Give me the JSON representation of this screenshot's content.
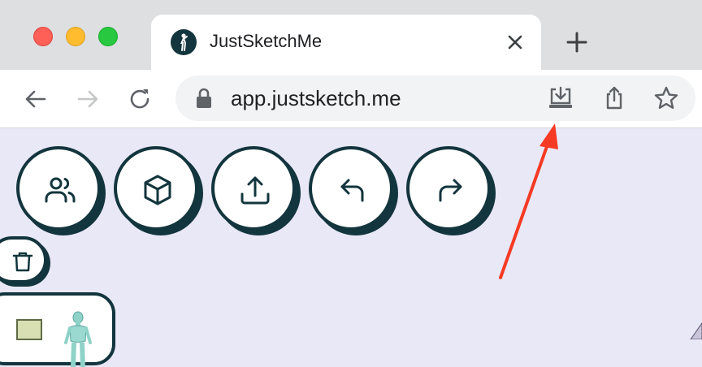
{
  "window": {
    "traffic_lights": [
      "close",
      "minimize",
      "zoom"
    ]
  },
  "tab": {
    "title": "JustSketchMe",
    "favicon": "mannequin-logo-icon"
  },
  "toolbar": {
    "url": "app.justsketch.me",
    "icons": [
      "back-icon",
      "forward-icon",
      "reload-icon",
      "lock-icon",
      "install-app-icon",
      "share-icon",
      "bookmark-star-icon"
    ]
  },
  "app": {
    "buttons": [
      "users-icon",
      "cube-icon",
      "upload-icon",
      "undo-icon",
      "redo-icon"
    ],
    "trash": "trash-icon",
    "panel": [
      "swatch",
      "mannequin-thumbnail"
    ]
  },
  "annotation": {
    "arrow_color": "#f63a23",
    "points_to": "install-app-icon"
  },
  "colors": {
    "app_background": "#e9e8f7",
    "app_outline": "#13353d",
    "titlebar": "#dedfe1"
  }
}
